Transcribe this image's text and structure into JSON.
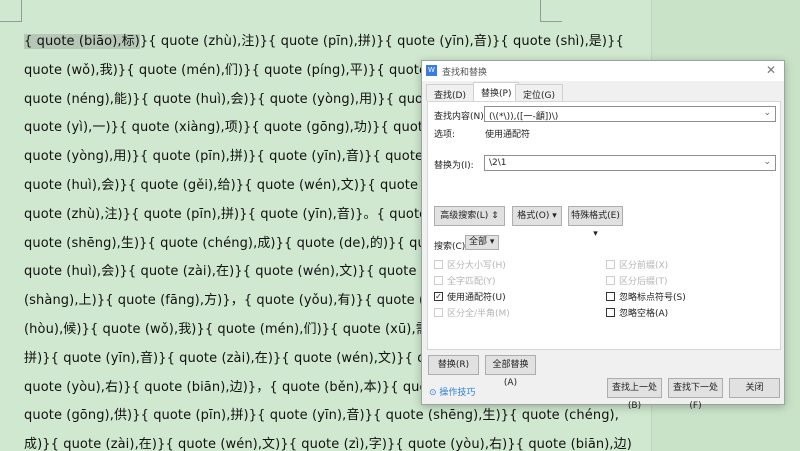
{
  "document": {
    "lines": [
      "{ quote (biāo),标)}{ quote (zhù),注)}{ quote (pīn),拼)}{ quote (yīn),音)}{ quote (shì),是)}{",
      "quote (wǒ),我)}{ quote (mén),们)}{ quote (píng),平)}{ quote (shí),时",
      "quote (néng),能)}{ quote (huì),会)}{ quote (yòng),用)}{ quote (dào),到",
      "quote (yì),一)}{ quote (xiàng),项)}{ quote (gōng),功)}{ quote (néng),能",
      "quote (yòng),用)}{ quote (pīn),拼)}{ quote (yīn),音)}{ quote (zhǐ),指",
      "quote (huì),会)}{ quote (gěi),给)}{ quote (wén),文)}{ quote (zì),字)",
      "quote (zhù),注)}{ quote (pīn),拼)}{ quote (yīn),音)}。{ quote (bú),不)}",
      "quote (shēng),生)}{ quote (chéng),成)}{ quote (de),的)}{ quote (pīn),拼",
      "quote (huì),会)}{ quote (zài),在)}{ quote (wén),文)}{ quote (zì),字)}{ q",
      "(shàng),上)}{ quote (fāng),方)}，{ quote (yǒu),有)}{ quote (xiē),些)}{ q",
      "(hòu),候)}{ quote (wǒ),我)}{ quote (mén),们)}{ quote (xū),需)}{ quote (",
      "拼)}{ quote (yīn),音)}{ quote (zài),在)}{ quote (wén),文)}{ quote (zì),",
      "quote (yòu),右)}{ quote (biān),边)}，{ quote (běn),本)}{ quote (wén",
      "quote (gōng),供)}{ quote (pīn),拼)}{ quote (yīn),音)}{ quote (shēng),生)}{ quote (chéng),",
      "成)}{ quote (zài),在)}{ quote (wén),文)}{ quote (zì),字)}{ quote (yòu),右)}{ quote (biān),边)"
    ],
    "selected": "{ quote (biāo),标)"
  },
  "dialog": {
    "title": "查找和替换",
    "app_icon": "W",
    "close": "✕",
    "tabs": [
      "查找(D)",
      "替换(P)",
      "定位(G)"
    ],
    "find_label": "查找内容(N):",
    "find_value": "(\\(*\\)),([一-龥])\\)",
    "options_label": "选项:",
    "options_value": "使用通配符",
    "replace_label": "替换为(I):",
    "replace_value": "\\2\\1",
    "adv_search": "高级搜索(L) ⇕",
    "format": "格式(O) ▾",
    "special": "特殊格式(E) ▾",
    "search_label": "搜索(C)",
    "search_value": "全部",
    "checkboxes": [
      {
        "label": "区分大小写(H)",
        "checked": false,
        "enabled": false
      },
      {
        "label": "全字匹配(Y)",
        "checked": false,
        "enabled": false
      },
      {
        "label": "使用通配符(U)",
        "checked": true,
        "enabled": true
      },
      {
        "label": "区分全/半角(M)",
        "checked": false,
        "enabled": false
      },
      {
        "label": "区分前缀(X)",
        "checked": false,
        "enabled": false
      },
      {
        "label": "区分后缀(T)",
        "checked": false,
        "enabled": false
      },
      {
        "label": "忽略标点符号(S)",
        "checked": false,
        "enabled": true
      },
      {
        "label": "忽略空格(A)",
        "checked": false,
        "enabled": true
      }
    ],
    "replace_btn": "替换(R)",
    "replace_all_btn": "全部替换(A)",
    "tips": "操作技巧",
    "find_prev": "查找上一处(B)",
    "find_next": "查找下一处(F)",
    "close_btn": "关闭",
    "link_color": "#2f7fd4"
  }
}
